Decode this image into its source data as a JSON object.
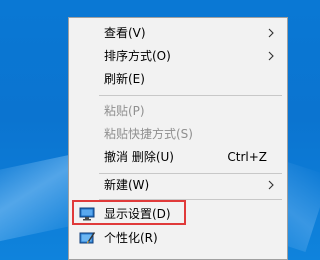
{
  "context_menu": {
    "view": {
      "label": "查看(V)"
    },
    "sort_by": {
      "label": "排序方式(O)"
    },
    "refresh": {
      "label": "刷新(E)"
    },
    "paste": {
      "label": "粘贴(P)"
    },
    "paste_shortcut": {
      "label": "粘贴快捷方式(S)"
    },
    "undo_delete": {
      "label": "撤消 删除(U)",
      "shortcut": "Ctrl+Z"
    },
    "new": {
      "label": "新建(W)"
    },
    "display_settings": {
      "label": "显示设置(D)",
      "icon": "display-icon"
    },
    "personalize": {
      "label": "个性化(R)",
      "icon": "personalize-icon"
    }
  },
  "colors": {
    "desktop": "#0a78d4",
    "menu_background": "#f2f2f2",
    "highlight_box": "#e03a3a"
  }
}
